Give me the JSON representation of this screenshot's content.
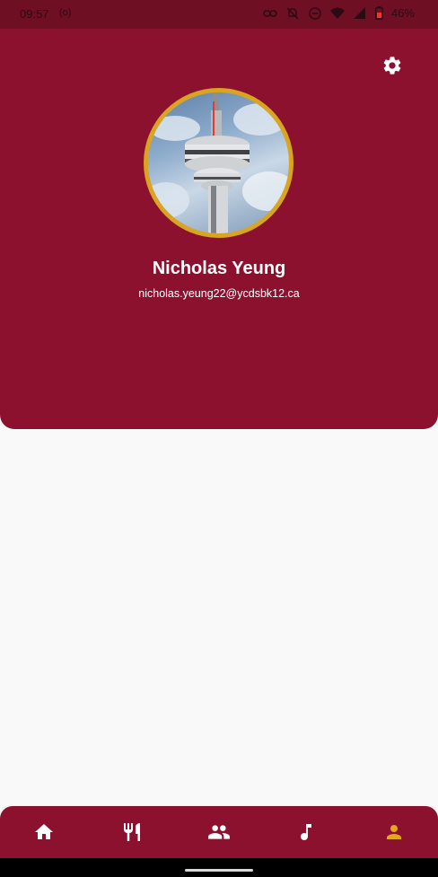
{
  "status_bar": {
    "time": "09:57",
    "cast_indicator": "(o)",
    "battery_percent": "46%",
    "icons": [
      "link-icon",
      "bell-off-icon",
      "dnd-icon",
      "wifi-icon",
      "signal-icon",
      "battery-icon"
    ]
  },
  "profile": {
    "name": "Nicholas Yeung",
    "email": "nicholas.yeung22@ycdsbk12.ca",
    "avatar_alt": "CN Tower photo"
  },
  "toolbar": {
    "settings_icon": "gear-icon"
  },
  "bottom_nav": {
    "items": [
      {
        "icon": "home-icon",
        "active": false
      },
      {
        "icon": "utensils-icon",
        "active": false
      },
      {
        "icon": "people-icon",
        "active": false
      },
      {
        "icon": "music-note-icon",
        "active": false
      },
      {
        "icon": "person-icon",
        "active": true
      }
    ]
  },
  "colors": {
    "primary": "#8b112f",
    "status_bar": "#6e0f24",
    "accent": "#d9a520",
    "background": "#f9f9f9",
    "nav_icon": "#ffffff",
    "nav_icon_active": "#e0a81e"
  }
}
